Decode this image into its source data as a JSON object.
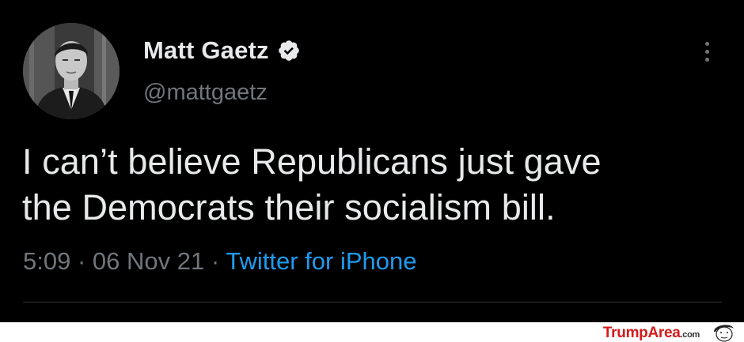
{
  "tweet": {
    "display_name": "Matt Gaetz",
    "handle": "@mattgaetz",
    "text_line1": "I can’t believe Republicans just gave",
    "text_line2": "the Democrats their socialism bill.",
    "time": "5:09",
    "date": "06 Nov 21",
    "separator": "·",
    "source": "Twitter for iPhone"
  },
  "icons": {
    "verified": "verified-badge-icon",
    "more": "more-options-icon",
    "avatar": "profile-photo"
  },
  "watermark": {
    "brand": "TrumpArea",
    "suffix": ".com"
  },
  "colors": {
    "background": "#000000",
    "text": "#e7e9ea",
    "secondary": "#71767b",
    "link": "#1d9bf0",
    "watermark": "#d61a1a"
  }
}
